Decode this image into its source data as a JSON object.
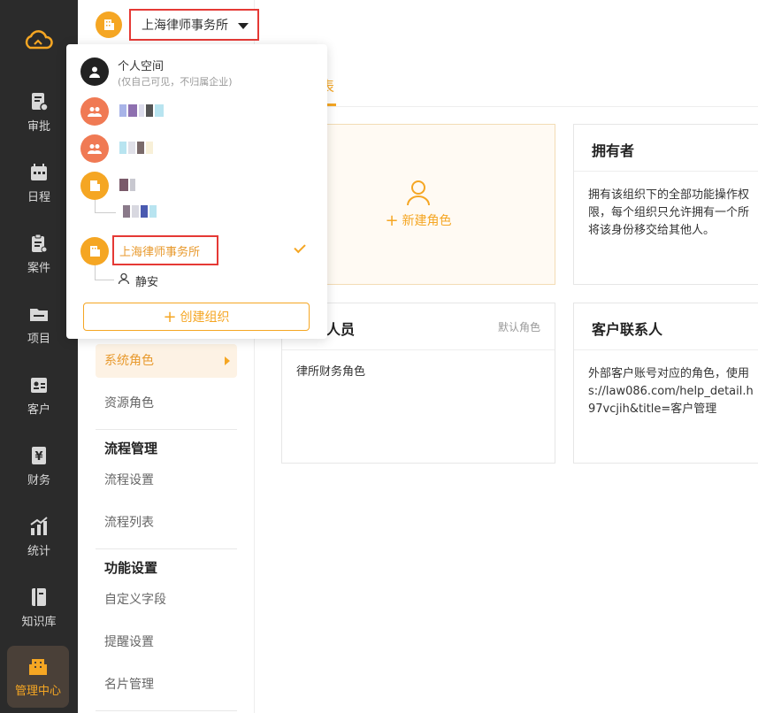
{
  "nav": {
    "items": [
      {
        "label": "审批",
        "icon": "approval-icon"
      },
      {
        "label": "日程",
        "icon": "calendar-icon"
      },
      {
        "label": "案件",
        "icon": "case-icon"
      },
      {
        "label": "项目",
        "icon": "project-icon"
      },
      {
        "label": "客户",
        "icon": "client-icon"
      },
      {
        "label": "财务",
        "icon": "finance-icon"
      },
      {
        "label": "统计",
        "icon": "stats-icon"
      },
      {
        "label": "知识库",
        "icon": "knowledge-icon"
      },
      {
        "label": "管理中心",
        "icon": "admin-icon"
      }
    ]
  },
  "topbar": {
    "org_name": "上海律师事务所"
  },
  "dropdown": {
    "personal_title": "个人空间",
    "personal_sub": "(仅自己可见，不归属企业)",
    "selected_org": "上海律师事务所",
    "sub_member": "静安",
    "create_label": "创建组织"
  },
  "sidebar": {
    "system_roles": "系统角色",
    "resource_roles": "资源角色",
    "process_heading": "流程管理",
    "process_settings": "流程设置",
    "process_list": "流程列表",
    "feature_heading": "功能设置",
    "custom_fields": "自定义字段",
    "reminder_settings": "提醒设置",
    "card_management": "名片管理"
  },
  "main": {
    "tab_label": "表",
    "new_role_label": "新建角色",
    "owner_title": "拥有者",
    "owner_desc_lines": [
      "拥有该组织下的全部功能操作权",
      "限，每个组织只允许拥有一个所",
      "将该身份移交给其他人。"
    ],
    "staff_title": "人员",
    "staff_tag": "默认角色",
    "staff_desc": "律所财务角色",
    "client_title": "客户联系人",
    "client_desc_lines": [
      "外部客户账号对应的角色，使用",
      "s://law086.com/help_detail.h",
      "97vcjih&title=客户管理"
    ]
  },
  "colors": {
    "accent": "#f5a623",
    "highlight_border": "#e53935",
    "sidebar_bg": "#2b2b2b"
  }
}
